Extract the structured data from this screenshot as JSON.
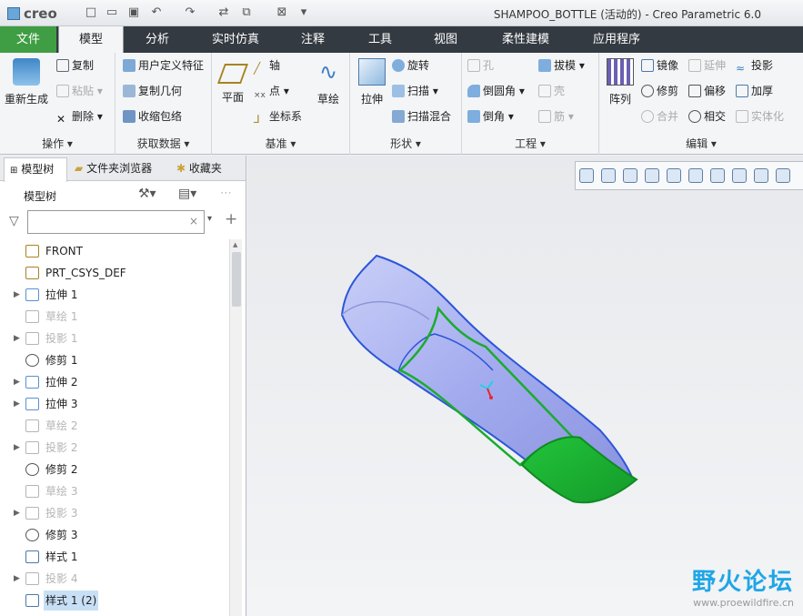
{
  "app": {
    "logo": "creo",
    "window_title": "SHAMPOO_BOTTLE (活动的) - Creo Parametric 6.0"
  },
  "tabs": [
    "文件",
    "模型",
    "分析",
    "实时仿真",
    "注释",
    "工具",
    "视图",
    "柔性建模",
    "应用程序"
  ],
  "ribbon": {
    "operations": {
      "label": "操作",
      "regen": "重新生成",
      "copy": "复制",
      "paste": "粘贴",
      "delete": "删除"
    },
    "get_data": {
      "label": "获取数据",
      "udf": "用户定义特征",
      "copy_geom": "复制几何",
      "shrinkwrap": "收缩包络"
    },
    "datum": {
      "label": "基准",
      "plane": "平面",
      "axis": "轴",
      "point": "点",
      "csys": "坐标系",
      "sketch": "草绘"
    },
    "shapes": {
      "label": "形状",
      "extrude": "拉伸",
      "revolve": "旋转",
      "sweep": "扫描",
      "swept_blend": "扫描混合"
    },
    "engineering": {
      "label": "工程",
      "hole": "孔",
      "round": "倒圆角",
      "chamfer": "倒角",
      "draft": "拔模",
      "shell": "壳",
      "rib": "筋"
    },
    "editing": {
      "label": "编辑",
      "pattern": "阵列",
      "mirror": "镜像",
      "extend": "延伸",
      "project": "投影",
      "trim": "修剪",
      "offset": "偏移",
      "thicken": "加厚",
      "merge": "合并",
      "intersect": "相交",
      "solidify": "实体化"
    }
  },
  "panel": {
    "tabs": [
      "模型树",
      "文件夹浏览器",
      "收藏夹"
    ],
    "title": "模型树",
    "filter_placeholder": "",
    "tree": [
      {
        "label": "FRONT",
        "expandable": false,
        "dim": false,
        "icon": "plane-icon"
      },
      {
        "label": "PRT_CSYS_DEF",
        "expandable": false,
        "dim": false,
        "icon": "csys-icon"
      },
      {
        "label": "拉伸 1",
        "expandable": true,
        "dim": false,
        "icon": "extrude-icon"
      },
      {
        "label": "草绘 1",
        "expandable": false,
        "dim": true,
        "icon": "sketch-icon"
      },
      {
        "label": "投影 1",
        "expandable": true,
        "dim": true,
        "icon": "project-icon"
      },
      {
        "label": "修剪 1",
        "expandable": false,
        "dim": false,
        "icon": "trim-icon"
      },
      {
        "label": "拉伸 2",
        "expandable": true,
        "dim": false,
        "icon": "extrude-icon"
      },
      {
        "label": "拉伸 3",
        "expandable": true,
        "dim": false,
        "icon": "extrude-icon"
      },
      {
        "label": "草绘 2",
        "expandable": false,
        "dim": true,
        "icon": "sketch-icon"
      },
      {
        "label": "投影 2",
        "expandable": true,
        "dim": true,
        "icon": "project-icon"
      },
      {
        "label": "修剪 2",
        "expandable": false,
        "dim": false,
        "icon": "trim-icon"
      },
      {
        "label": "草绘 3",
        "expandable": false,
        "dim": true,
        "icon": "sketch-icon"
      },
      {
        "label": "投影 3",
        "expandable": true,
        "dim": true,
        "icon": "project-icon"
      },
      {
        "label": "修剪 3",
        "expandable": false,
        "dim": false,
        "icon": "trim-icon"
      },
      {
        "label": "样式 1",
        "expandable": false,
        "dim": false,
        "icon": "style-icon"
      },
      {
        "label": "投影 4",
        "expandable": true,
        "dim": true,
        "icon": "project-icon"
      },
      {
        "label": "样式 1 (2)",
        "expandable": false,
        "dim": false,
        "icon": "style-icon",
        "selected": true
      }
    ]
  },
  "watermark": {
    "name": "野火论坛",
    "url": "www.proewildfire.cn"
  }
}
